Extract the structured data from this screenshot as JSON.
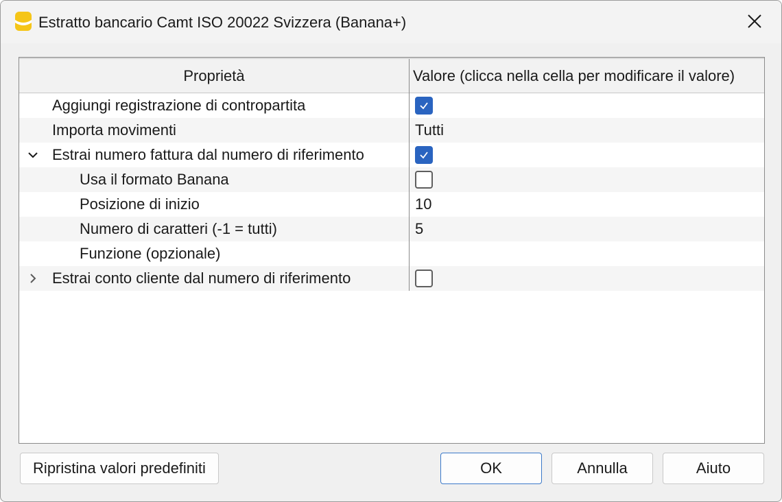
{
  "window": {
    "title": "Estratto bancario Camt ISO 20022 Svizzera (Banana+)",
    "app_icon": "banana-app-icon",
    "close_icon": "close-icon"
  },
  "grid": {
    "columns": {
      "property": "Proprietà",
      "value": "Valore (clicca nella cella per modificare il valore)"
    },
    "rows": [
      {
        "label": "Aggiungi registrazione di contropartita",
        "type": "checkbox",
        "checked": true
      },
      {
        "label": "Importa movimenti",
        "type": "text",
        "value": "Tutti"
      },
      {
        "label": "Estrai numero fattura dal numero di riferimento",
        "type": "checkbox",
        "checked": true,
        "expander": "chevron-down-icon"
      },
      {
        "label": "Usa il formato Banana",
        "type": "checkbox",
        "checked": false
      },
      {
        "label": "Posizione di inizio",
        "type": "text",
        "value": "10"
      },
      {
        "label": "Numero di caratteri (-1 = tutti)",
        "type": "text",
        "value": "5"
      },
      {
        "label": "Funzione (opzionale)",
        "type": "text",
        "value": ""
      },
      {
        "label": "Estrai conto cliente dal numero di riferimento",
        "type": "checkbox",
        "checked": false,
        "expander": "chevron-right-icon"
      }
    ]
  },
  "buttons": {
    "reset": "Ripristina valori predefiniti",
    "ok": "OK",
    "cancel": "Annulla",
    "help": "Aiuto"
  },
  "colors": {
    "checkbox_checked": "#2a64c0",
    "primary_button_border": "#3a78c8"
  }
}
